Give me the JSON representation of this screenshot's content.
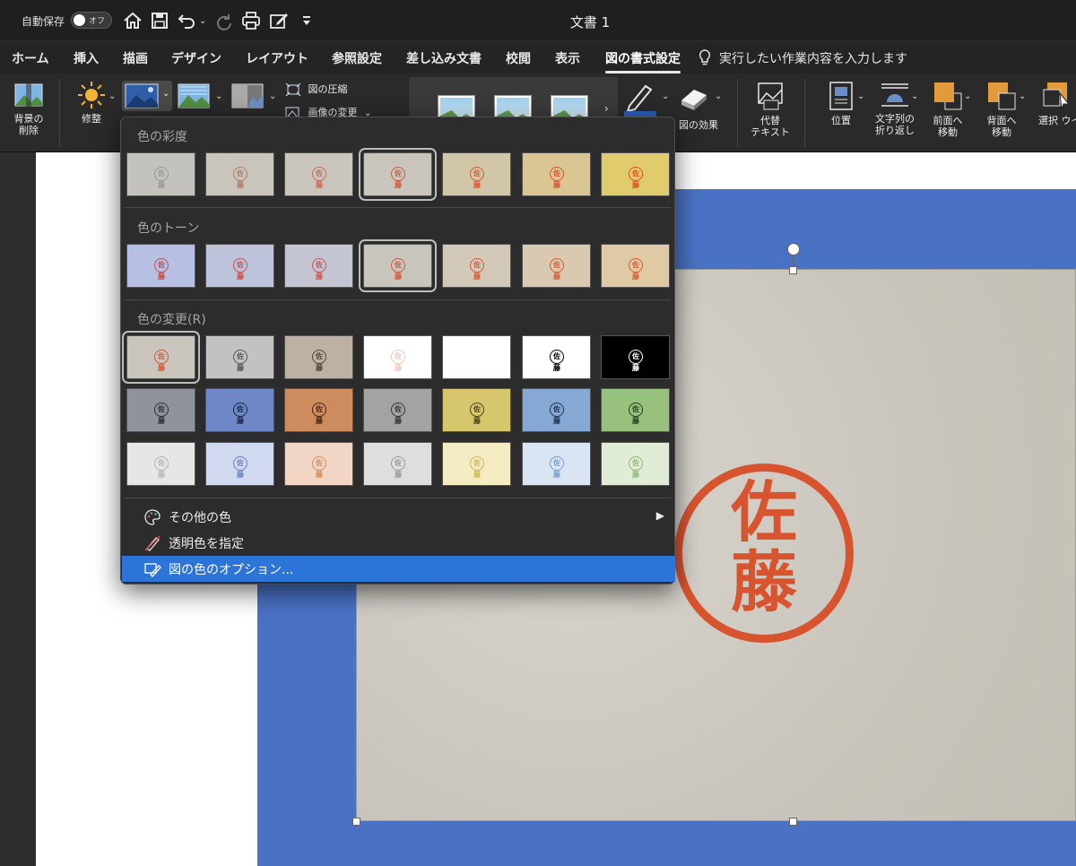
{
  "titlebar": {
    "autosave_label": "自動保存",
    "toggle_label": "オフ",
    "doc_title": "文書 1"
  },
  "tabs": [
    "ホーム",
    "挿入",
    "描画",
    "デザイン",
    "レイアウト",
    "参照設定",
    "差し込み文書",
    "校閲",
    "表示",
    "図の書式設定"
  ],
  "active_tab": "図の書式設定",
  "tellme": "実行したい作業内容を入力します",
  "ribbon": {
    "remove_bg": "背景の\n削除",
    "corrections": "修整",
    "compress": "図の圧縮",
    "change_picture": "画像の変更",
    "picture_effects": "図の効果",
    "alt_text": "代替\nテキスト",
    "position": "位置",
    "wrap_text": "文字列の\n折り返し",
    "bring_forward": "前面へ\n移動",
    "send_backward": "背面へ\n移動",
    "selection_pane": "選択\nウインドウ"
  },
  "color_menu": {
    "saturation_title": "色の彩度",
    "tone_title": "色のトーン",
    "recolor_title": "色の変更(R)",
    "seal_glyph": "佐藤",
    "saturation": [
      {
        "bg": "#c4c2bd",
        "ink": "#9a9a9a"
      },
      {
        "bg": "#c9c5bd",
        "ink": "#b07a6a"
      },
      {
        "bg": "#cbc6bd",
        "ink": "#c26c55"
      },
      {
        "bg": "#c9c5bc",
        "ink": "#d0583a",
        "selected": true
      },
      {
        "bg": "#d1c6a8",
        "ink": "#d65a38"
      },
      {
        "bg": "#d9c692",
        "ink": "#df5030"
      },
      {
        "bg": "#e0cc6c",
        "ink": "#e84a25"
      }
    ],
    "tone": [
      {
        "bg": "#b7bfe2",
        "ink": "#c0504a"
      },
      {
        "bg": "#bec3dc",
        "ink": "#c4544a"
      },
      {
        "bg": "#c3c5d2",
        "ink": "#c8564a"
      },
      {
        "bg": "#c9c5bc",
        "ink": "#d0583a",
        "selected": true
      },
      {
        "bg": "#d2c9b9",
        "ink": "#d45a3a"
      },
      {
        "bg": "#d8c9b0",
        "ink": "#d85a36"
      },
      {
        "bg": "#e0caa5",
        "ink": "#dc5a32"
      }
    ],
    "recolor": [
      [
        {
          "bg": "#c9c5bc",
          "ink": "#d0583a",
          "selected": true
        },
        {
          "bg": "#c2c2c2",
          "ink": "#555555"
        },
        {
          "bg": "#bcb1a2",
          "ink": "#4f4538"
        },
        {
          "bg": "#ffffff",
          "ink": "#f1c9c0"
        },
        {
          "bg": "#ffffff",
          "ink": "#ffffff"
        },
        {
          "bg": "#ffffff",
          "ink": "#000000"
        },
        {
          "bg": "#000000",
          "ink": "#ffffff"
        }
      ],
      [
        {
          "bg": "#8e939c",
          "ink": "#2d2f34"
        },
        {
          "bg": "#6f86c7",
          "ink": "#1b2546"
        },
        {
          "bg": "#cc8c5e",
          "ink": "#4a2611"
        },
        {
          "bg": "#a3a3a3",
          "ink": "#333333"
        },
        {
          "bg": "#d6c76c",
          "ink": "#4c4217"
        },
        {
          "bg": "#86a8d4",
          "ink": "#1c324e"
        },
        {
          "bg": "#99c17e",
          "ink": "#22401a"
        }
      ],
      [
        {
          "bg": "#e6e6e6",
          "ink": "#b5b5b5"
        },
        {
          "bg": "#d1daf0",
          "ink": "#6c80c0"
        },
        {
          "bg": "#f1d6c5",
          "ink": "#d28a5e"
        },
        {
          "bg": "#dedede",
          "ink": "#9a9a9a"
        },
        {
          "bg": "#f5ecc4",
          "ink": "#cfb55a"
        },
        {
          "bg": "#dae5f3",
          "ink": "#7a9ccb"
        },
        {
          "bg": "#e0ecd5",
          "ink": "#8fb878"
        }
      ]
    ],
    "items": [
      {
        "label": "その他の色",
        "icon": "palette-icon",
        "has_submenu": true
      },
      {
        "label": "透明色を指定",
        "icon": "transparent-color-pen-icon"
      },
      {
        "label": "図の色のオプション...",
        "icon": "picture-color-options-icon",
        "highlighted": true
      }
    ]
  },
  "document": {
    "seal_text_top": "佐",
    "seal_text_bottom": "藤",
    "seal_color": "#d8542f",
    "frame_color": "#4a72c4"
  }
}
